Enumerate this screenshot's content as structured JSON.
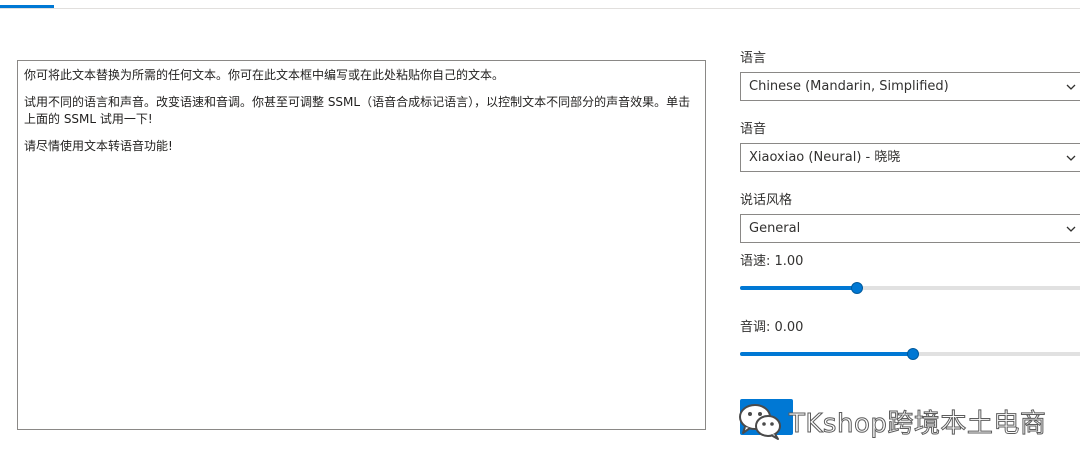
{
  "editor": {
    "paragraphs": [
      "你可将此文本替换为所需的任何文本。你可在此文本框中编写或在此处粘贴你自己的文本。",
      "试用不同的语言和声音。改变语速和音调。你甚至可调整 SSML（语音合成标记语言），以控制文本不同部分的声音效果。单击上面的 SSML 试用一下!",
      "请尽情使用文本转语音功能!"
    ]
  },
  "settings": {
    "language_label": "语言",
    "language_value": "Chinese (Mandarin, Simplified)",
    "voice_label": "语音",
    "voice_value": "Xiaoxiao (Neural) - 晓晓",
    "style_label": "说话风格",
    "style_value": "General",
    "speed_label": "语速: 1.00",
    "speed_fraction": 0.34,
    "pitch_label": "音调: 0.00",
    "pitch_fraction": 0.5
  },
  "watermark": {
    "text": "TKshop跨境本土电商",
    "icon": "wechat-icon"
  },
  "colors": {
    "accent": "#0078d4",
    "border": "#8a8886"
  }
}
